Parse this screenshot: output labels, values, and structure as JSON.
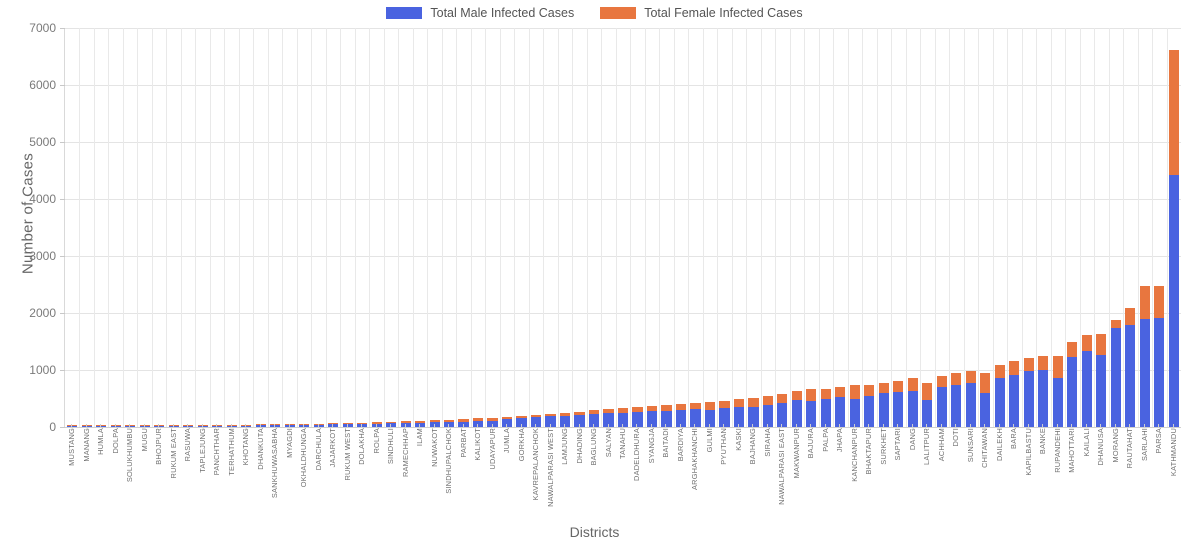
{
  "legend": {
    "items": [
      {
        "label": "Total Male Infected Cases",
        "color": "#4a63e0",
        "name": "legend-male"
      },
      {
        "label": "Total Female Infected Cases",
        "color": "#e8763f",
        "name": "legend-female"
      }
    ]
  },
  "axes": {
    "ylabel": "Number of Cases",
    "xlabel": "Districts"
  },
  "chart_data": {
    "type": "bar",
    "title": "",
    "subtitle": "",
    "xlabel": "Districts",
    "ylabel": "Number of Cases",
    "ylim": [
      0,
      7000
    ],
    "yticks": [
      0,
      1000,
      2000,
      3000,
      4000,
      5000,
      6000,
      7000
    ],
    "grid": true,
    "stacked": true,
    "legend_position": "top-center",
    "orientation": "vertical",
    "categories": [
      "MUSTANG",
      "MANANG",
      "HUMLA",
      "DOLPA",
      "SOLUKHUMBU",
      "MUGU",
      "BHOJPUR",
      "RUKUM EAST",
      "RASUWA",
      "TAPLEJUNG",
      "PANCHTHAR",
      "TERHATHUM",
      "KHOTANG",
      "DHANKUTA",
      "SANKHUWASABHA",
      "MYAGDI",
      "OKHALDHUNGA",
      "DARCHULA",
      "JAJARKOT",
      "RUKUM WEST",
      "DOLAKHA",
      "ROLPA",
      "SINDHULI",
      "RAMECHHAP",
      "ILAM",
      "NUWAKOT",
      "SINDHUPALCHOK",
      "PARBAT",
      "KALIKOT",
      "UDAYAPUR",
      "JUMLA",
      "GORKHA",
      "KAVREPALANCHOK",
      "NAWALPARASI WEST",
      "LAMJUNG",
      "DHADING",
      "BAGLUNG",
      "SALYAN",
      "TANAHU",
      "DADELDHURA",
      "SYANGJA",
      "BAITADI",
      "BARDIYA",
      "ARGHAKHANCHI",
      "GULMI",
      "PYUTHAN",
      "KASKI",
      "BAJHANG",
      "SIRAHA",
      "NAWALPARASI EAST",
      "MAKWANPUR",
      "BAJURA",
      "PALPA",
      "JHAPA",
      "KANCHANPUR",
      "BHAKTAPUR",
      "SURKHET",
      "SAPTARI",
      "DANG",
      "LALITPUR",
      "ACHHAM",
      "DOTI",
      "SUNSARI",
      "CHITAWAN",
      "DAILEKH",
      "BARA",
      "KAPILBASTU",
      "BANKE",
      "RUPANDEHI",
      "MAHOTTARI",
      "KAILALI",
      "DHANUSA",
      "MORANG",
      "RAUTAHAT",
      "SARLAHI",
      "PARSA",
      "KATHMANDU"
    ],
    "series": [
      {
        "name": "Total Male Infected Cases",
        "color": "#4a63e0",
        "values": [
          3,
          4,
          8,
          9,
          11,
          13,
          15,
          16,
          17,
          19,
          21,
          23,
          26,
          29,
          32,
          35,
          38,
          41,
          45,
          50,
          55,
          60,
          65,
          70,
          76,
          82,
          90,
          96,
          103,
          110,
          145,
          160,
          172,
          185,
          196,
          208,
          222,
          238,
          250,
          262,
          276,
          286,
          300,
          312,
          300,
          330,
          345,
          352,
          382,
          430,
          470,
          455,
          500,
          520,
          495,
          545,
          600,
          615,
          640,
          470,
          705,
          735,
          775,
          590,
          860,
          920,
          980,
          1005,
          860,
          1225,
          1340,
          1255,
          1740,
          1790,
          1900,
          1920,
          4430
        ]
      },
      {
        "name": "Total Female Infected Cases",
        "color": "#e8763f",
        "values": [
          1,
          2,
          3,
          4,
          5,
          5,
          6,
          7,
          7,
          8,
          9,
          10,
          11,
          12,
          13,
          15,
          16,
          18,
          20,
          22,
          24,
          26,
          28,
          31,
          34,
          37,
          40,
          44,
          47,
          50,
          25,
          30,
          38,
          45,
          54,
          62,
          68,
          72,
          80,
          88,
          94,
          104,
          110,
          118,
          145,
          130,
          140,
          158,
          168,
          150,
          160,
          205,
          175,
          185,
          245,
          195,
          175,
          200,
          215,
          300,
          195,
          205,
          215,
          350,
          220,
          230,
          235,
          245,
          390,
          265,
          270,
          370,
          145,
          290,
          580,
          560,
          2190
        ]
      }
    ]
  }
}
